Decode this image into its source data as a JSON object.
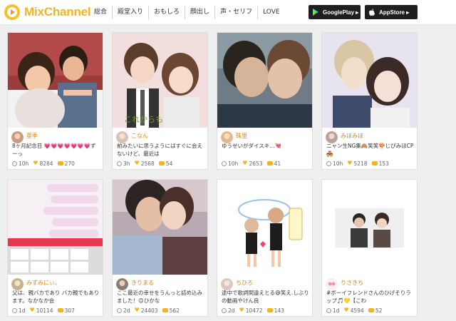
{
  "header": {
    "logo": "MixChannel",
    "nav": [
      "総合",
      "殿堂入り",
      "おもしろ",
      "顔出し",
      "声・セリフ",
      "LOVE"
    ],
    "google_play": "GooglePlay ▸",
    "app_store": "AppStore ▸"
  },
  "colors": {
    "accent": "#f0b521",
    "username": "#d4891b",
    "store_button": "#1f1f1f"
  },
  "cards": [
    {
      "thumbnail": "couple-photo-1",
      "user": "亜季",
      "desc": "8ヶ月記念日 💗💗💗💗💗💗💗ずーっ",
      "time": "10h",
      "likes": "8284",
      "comments": "270"
    },
    {
      "thumbnail": "couple-photo-2",
      "user": "こなん",
      "desc": "前みたいに思うようにはすぐに会えないけど、最近は",
      "time": "3h",
      "likes": "2568",
      "comments": "54"
    },
    {
      "thumbnail": "couple-photo-3",
      "user": "珠里",
      "desc": "ゆうせいがダイスキ…💘",
      "time": "10h",
      "likes": "2653",
      "comments": "41"
    },
    {
      "thumbnail": "couple-photo-4",
      "user": "みほみほ",
      "desc": "ニャン生NG集🙈笑笑🍄じぴみほCP💑",
      "time": "10h",
      "likes": "5218",
      "comments": "153"
    },
    {
      "thumbnail": "chat-screenshot",
      "user": "みずみにぃ。",
      "desc": "父は、親バカであり バカ親でもあります。なかなか会",
      "time": "1d",
      "likes": "10114",
      "comments": "307"
    },
    {
      "thumbnail": "couple-photo-5",
      "user": "きりまる",
      "desc": "ここ最近の幸せをうんっと詰め込みました！😊ひかな",
      "time": "2d",
      "likes": "24403",
      "comments": "562"
    },
    {
      "thumbnail": "couple-illustration",
      "user": "ちひろ",
      "desc": "途中で歌詞間違えとる😅笑え.しぶりの動画やけん良",
      "time": "2d",
      "likes": "10472",
      "comments": "143"
    },
    {
      "thumbnail": "couple-photo-6",
      "user": "りさきち",
      "desc": "#ボーイフレンドさんのひげそりラップ🎵💛【こわ",
      "time": "1d",
      "likes": "4594",
      "comments": "52"
    }
  ]
}
